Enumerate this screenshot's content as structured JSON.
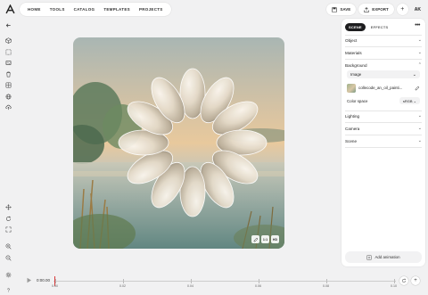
{
  "nav": {
    "items": [
      "HOME",
      "TOOLS",
      "CATALOG",
      "TEMPLATES",
      "PROJECTS"
    ]
  },
  "toolbar": {
    "save_label": "SAVE",
    "export_label": "EXPORT",
    "add_label": "+",
    "avatar": "AK"
  },
  "panel": {
    "tabs": [
      "SCENE",
      "EFFECTS"
    ],
    "more": "•••",
    "sections": [
      "Object",
      "Materials",
      "Background"
    ],
    "background": {
      "type_value": "Image",
      "image_name": "collecode_an_oil_painti...",
      "color_space_label": "Color space",
      "color_space_value": "sRGB"
    },
    "sections_after": [
      "Lighting",
      "Camera",
      "Scene"
    ],
    "add_animation_label": "Add animation"
  },
  "canvas_controls": [
    "1:1",
    "HD"
  ],
  "timeline": {
    "current_time": "0:00.00",
    "ticks": [
      "0.00",
      "0.02",
      "0.04",
      "0.06",
      "0.08",
      "0.10"
    ]
  },
  "left_tools": [
    "back-icon",
    "cube-icon",
    "select-icon",
    "frame-icon",
    "trash-icon",
    "layers-icon",
    "globe-icon",
    "upload-icon"
  ],
  "left_tools_lower": [
    "move-icon",
    "rotate-icon",
    "scale-icon",
    "zoom-in-icon",
    "zoom-out-icon",
    "settings-icon",
    "help-icon"
  ],
  "colors": {
    "accent": "#1d1d1f",
    "playhead": "#d93a3a",
    "background": "#f1f1f2"
  }
}
